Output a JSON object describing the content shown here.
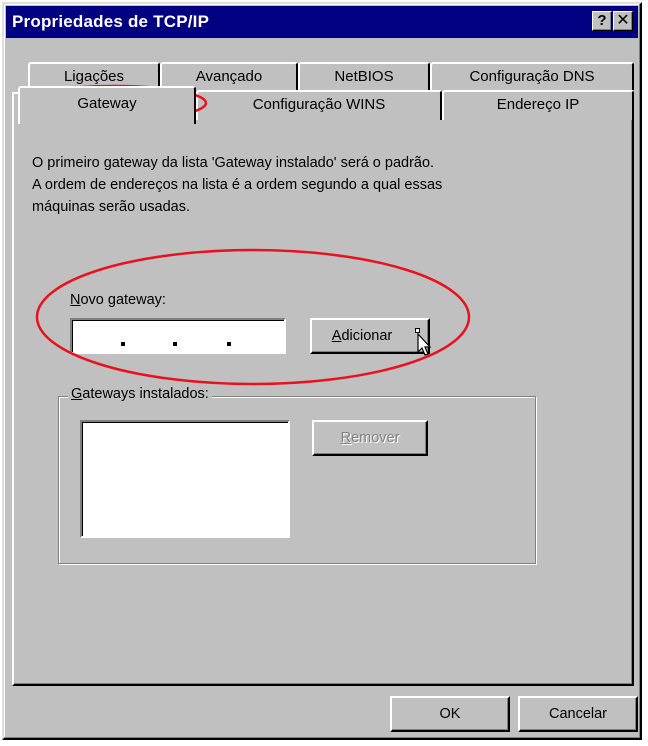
{
  "window": {
    "title": "Propriedades de TCP/IP",
    "help_glyph": "?",
    "close_glyph": "✕"
  },
  "tabs": {
    "back_row": [
      {
        "label": "Ligações"
      },
      {
        "label": "Avançado"
      },
      {
        "label": "NetBIOS"
      },
      {
        "label": "Configuração DNS"
      }
    ],
    "front_row": [
      {
        "label": "Gateway",
        "active": true
      },
      {
        "label": "Configuração WINS"
      },
      {
        "label": "Endereço IP"
      }
    ]
  },
  "description": {
    "line1": "O primeiro gateway da lista 'Gateway instalado' será o padrão.",
    "line2": "A ordem de endereços na lista é a ordem segundo a qual essas",
    "line3": "máquinas serão usadas."
  },
  "new_gateway": {
    "label_mnemonic": "N",
    "label_rest": "ovo gateway:",
    "ip_value": "",
    "add_mnemonic": "A",
    "add_rest": "dicionar"
  },
  "installed": {
    "label_mnemonic": "G",
    "label_rest": "ateways instalados:",
    "items": [],
    "remove_mnemonic": "R",
    "remove_rest": "emover"
  },
  "footer": {
    "ok": "OK",
    "cancel": "Cancelar"
  },
  "annotation_color": "#e8121f",
  "titlebar_color": "#000080"
}
